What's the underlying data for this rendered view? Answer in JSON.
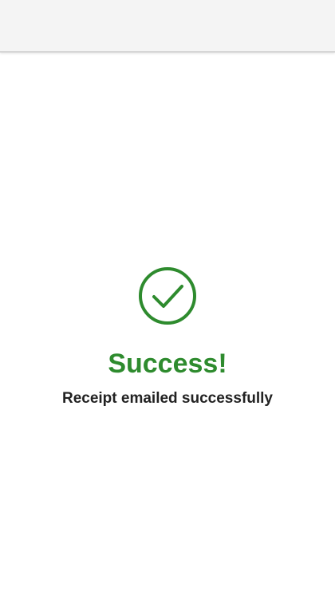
{
  "header": {
    "title": ""
  },
  "status": {
    "icon": "check-circle-icon",
    "title": "Success!",
    "message": "Receipt emailed successfully",
    "accent_color": "#2e8b2e"
  }
}
